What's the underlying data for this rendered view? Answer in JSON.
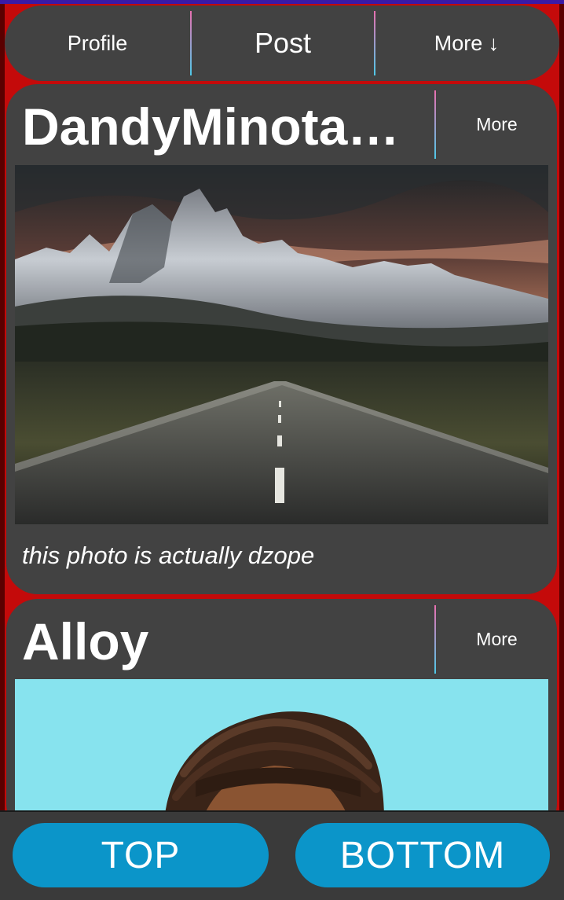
{
  "nav": {
    "profile_label": "Profile",
    "post_label": "Post",
    "more_label": "More ↓"
  },
  "posts": [
    {
      "username": "DandyMinotau...",
      "more_label": "More",
      "caption": "this photo is actually dzope",
      "image": "mountain-road-photo"
    },
    {
      "username": "Alloy",
      "more_label": "More",
      "image": "portrait-photo"
    }
  ],
  "bottom": {
    "top_label": "TOP",
    "bottom_label": "BOTTOM"
  },
  "colors": {
    "background": "#c40a0a",
    "card": "#424242",
    "button": "#0b95c9",
    "divider_top": "#e96fb0",
    "divider_bottom": "#4ec9e8"
  }
}
